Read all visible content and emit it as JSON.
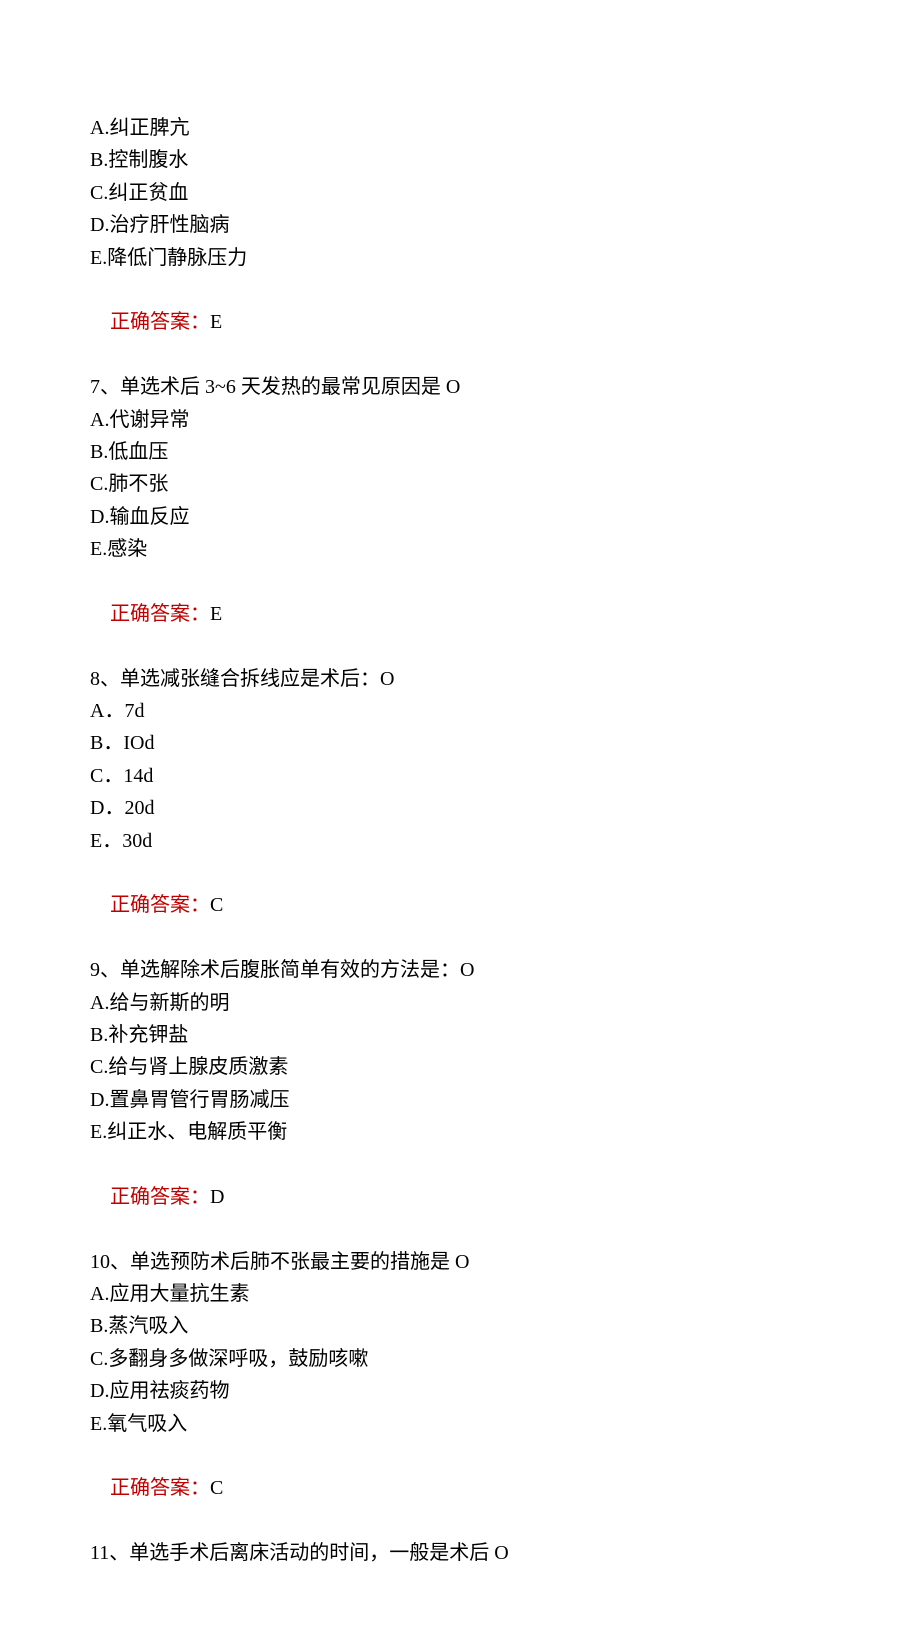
{
  "answer_label": "正确答案：",
  "q6": {
    "options": {
      "A": "A.纠正脾亢",
      "B": "B.控制腹水",
      "C": "C.纠正贫血",
      "D": "D.治疗肝性脑病",
      "E": "E.降低门静脉压力"
    },
    "answer": "E"
  },
  "q7": {
    "stem": "7、单选术后 3~6 天发热的最常见原因是 O",
    "options": {
      "A": "A.代谢异常",
      "B": "B.低血压",
      "C": "C.肺不张",
      "D": "D.输血反应",
      "E": "E.感染"
    },
    "answer": "E"
  },
  "q8": {
    "stem": "8、单选减张缝合拆线应是术后：O",
    "options": {
      "A": "A．7d",
      "B": "B．IOd",
      "C": "C．14d",
      "D": "D．20d",
      "E": "E．30d"
    },
    "answer": "C"
  },
  "q9": {
    "stem": "9、单选解除术后腹胀简单有效的方法是：O",
    "options": {
      "A": "A.给与新斯的明",
      "B": "B.补充钾盐",
      "C": "C.给与肾上腺皮质激素",
      "D": "D.置鼻胃管行胃肠减压",
      "E": "E.纠正水、电解质平衡"
    },
    "answer": "D"
  },
  "q10": {
    "stem": "10、单选预防术后肺不张最主要的措施是 O",
    "options": {
      "A": "A.应用大量抗生素",
      "B": "B.蒸汽吸入",
      "C": "C.多翻身多做深呼吸，鼓励咳嗽",
      "D": "D.应用祛痰药物",
      "E": "E.氧气吸入"
    },
    "answer": "C"
  },
  "q11": {
    "stem": "11、单选手术后离床活动的时间，一般是术后 O"
  }
}
